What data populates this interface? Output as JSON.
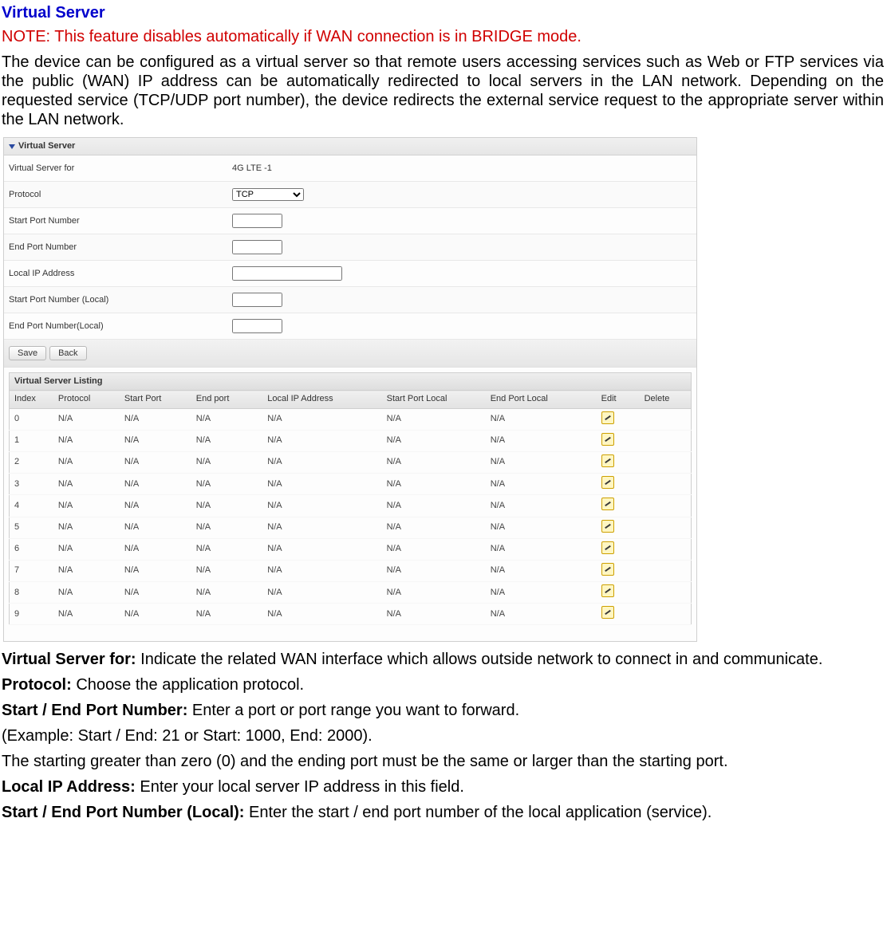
{
  "title": "Virtual Server",
  "note": "NOTE: This feature disables automatically if WAN connection is in BRIDGE mode.",
  "intro": "The device can be configured as a virtual server so that remote users accessing services such as Web or FTP services via the public (WAN) IP address can be automatically redirected to local servers in the LAN network. Depending on the requested service (TCP/UDP port number), the device redirects the external service request to the appropriate server within the LAN network.",
  "panel": {
    "header": "Virtual Server",
    "fields": {
      "virtual_server_for": {
        "label": "Virtual Server for",
        "value": "4G LTE -1"
      },
      "protocol": {
        "label": "Protocol",
        "value": "TCP"
      },
      "start_port": {
        "label": "Start Port Number",
        "value": ""
      },
      "end_port": {
        "label": "End Port Number",
        "value": ""
      },
      "local_ip": {
        "label": "Local IP Address",
        "value": ""
      },
      "start_port_local": {
        "label": "Start Port Number (Local)",
        "value": ""
      },
      "end_port_local": {
        "label": "End Port Number(Local)",
        "value": ""
      }
    },
    "buttons": {
      "save": "Save",
      "back": "Back"
    },
    "listing": {
      "title": "Virtual Server Listing",
      "columns": [
        "Index",
        "Protocol",
        "Start Port",
        "End port",
        "Local IP Address",
        "Start Port Local",
        "End Port Local",
        "Edit",
        "Delete"
      ],
      "rows": [
        {
          "index": "0",
          "protocol": "N/A",
          "start_port": "N/A",
          "end_port": "N/A",
          "local_ip": "N/A",
          "start_local": "N/A",
          "end_local": "N/A"
        },
        {
          "index": "1",
          "protocol": "N/A",
          "start_port": "N/A",
          "end_port": "N/A",
          "local_ip": "N/A",
          "start_local": "N/A",
          "end_local": "N/A"
        },
        {
          "index": "2",
          "protocol": "N/A",
          "start_port": "N/A",
          "end_port": "N/A",
          "local_ip": "N/A",
          "start_local": "N/A",
          "end_local": "N/A"
        },
        {
          "index": "3",
          "protocol": "N/A",
          "start_port": "N/A",
          "end_port": "N/A",
          "local_ip": "N/A",
          "start_local": "N/A",
          "end_local": "N/A"
        },
        {
          "index": "4",
          "protocol": "N/A",
          "start_port": "N/A",
          "end_port": "N/A",
          "local_ip": "N/A",
          "start_local": "N/A",
          "end_local": "N/A"
        },
        {
          "index": "5",
          "protocol": "N/A",
          "start_port": "N/A",
          "end_port": "N/A",
          "local_ip": "N/A",
          "start_local": "N/A",
          "end_local": "N/A"
        },
        {
          "index": "6",
          "protocol": "N/A",
          "start_port": "N/A",
          "end_port": "N/A",
          "local_ip": "N/A",
          "start_local": "N/A",
          "end_local": "N/A"
        },
        {
          "index": "7",
          "protocol": "N/A",
          "start_port": "N/A",
          "end_port": "N/A",
          "local_ip": "N/A",
          "start_local": "N/A",
          "end_local": "N/A"
        },
        {
          "index": "8",
          "protocol": "N/A",
          "start_port": "N/A",
          "end_port": "N/A",
          "local_ip": "N/A",
          "start_local": "N/A",
          "end_local": "N/A"
        },
        {
          "index": "9",
          "protocol": "N/A",
          "start_port": "N/A",
          "end_port": "N/A",
          "local_ip": "N/A",
          "start_local": "N/A",
          "end_local": "N/A"
        }
      ]
    }
  },
  "descriptions": {
    "virtual_server_for": {
      "label": "Virtual Server for:",
      "text": " Indicate the related WAN interface which allows outside network to connect in and communicate."
    },
    "protocol": {
      "label": "Protocol:",
      "text": " Choose the application protocol."
    },
    "start_end_port": {
      "label": "Start / End Port Number:",
      "text": " Enter a port or port range you want to forward."
    },
    "example": "(Example: Start / End: 21 or Start: 1000, End: 2000).",
    "rule": "The starting greater than zero (0) and the ending port must be the same or larger than the starting port.",
    "local_ip": {
      "label": "Local IP Address:",
      "text": " Enter your local server IP address in this field."
    },
    "start_end_local": {
      "label": "Start / End Port Number (Local):",
      "text": " Enter the start / end port number of the local application (service)."
    }
  }
}
